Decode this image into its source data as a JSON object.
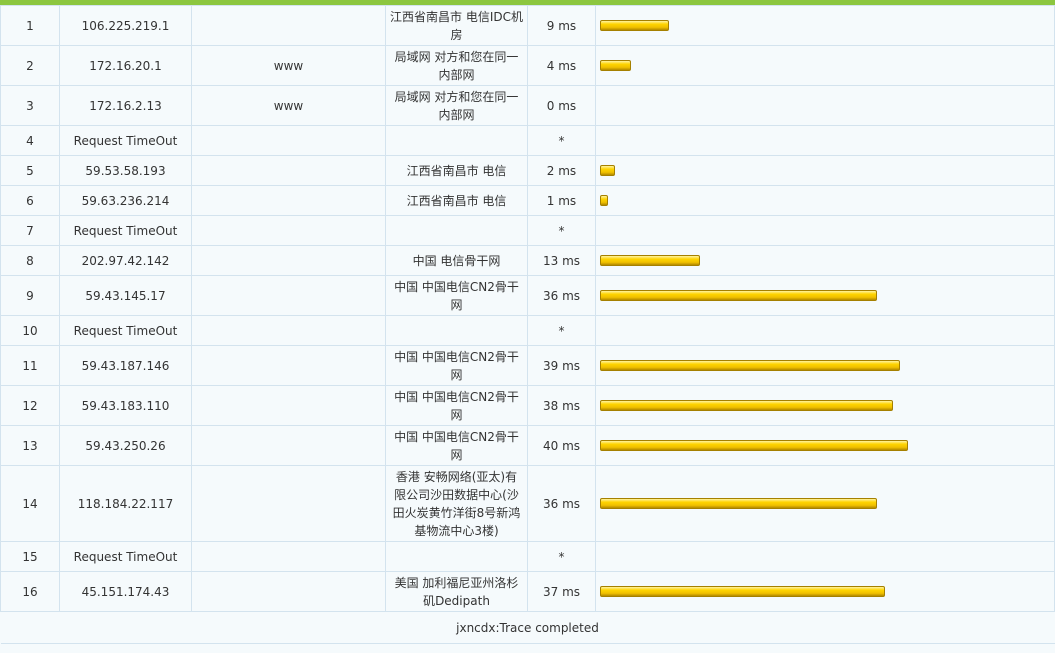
{
  "hops": [
    {
      "hop": "1",
      "ip": "106.225.219.1",
      "host": "",
      "location": "江西省南昌市 电信IDC机房",
      "rtt": "9 ms",
      "rtt_ms": 9
    },
    {
      "hop": "2",
      "ip": "172.16.20.1",
      "host": "www",
      "location": "局域网 对方和您在同一内部网",
      "rtt": "4 ms",
      "rtt_ms": 4
    },
    {
      "hop": "3",
      "ip": "172.16.2.13",
      "host": "www",
      "location": "局域网 对方和您在同一内部网",
      "rtt": "0 ms",
      "rtt_ms": 0
    },
    {
      "hop": "4",
      "ip": "Request TimeOut",
      "host": "",
      "location": "",
      "rtt": "*",
      "rtt_ms": null
    },
    {
      "hop": "5",
      "ip": "59.53.58.193",
      "host": "",
      "location": "江西省南昌市 电信",
      "rtt": "2 ms",
      "rtt_ms": 2
    },
    {
      "hop": "6",
      "ip": "59.63.236.214",
      "host": "",
      "location": "江西省南昌市 电信",
      "rtt": "1 ms",
      "rtt_ms": 1
    },
    {
      "hop": "7",
      "ip": "Request TimeOut",
      "host": "",
      "location": "",
      "rtt": "*",
      "rtt_ms": null
    },
    {
      "hop": "8",
      "ip": "202.97.42.142",
      "host": "",
      "location": "中国 电信骨干网",
      "rtt": "13 ms",
      "rtt_ms": 13
    },
    {
      "hop": "9",
      "ip": "59.43.145.17",
      "host": "",
      "location": "中国 中国电信CN2骨干网",
      "rtt": "36 ms",
      "rtt_ms": 36
    },
    {
      "hop": "10",
      "ip": "Request TimeOut",
      "host": "",
      "location": "",
      "rtt": "*",
      "rtt_ms": null
    },
    {
      "hop": "11",
      "ip": "59.43.187.146",
      "host": "",
      "location": "中国 中国电信CN2骨干网",
      "rtt": "39 ms",
      "rtt_ms": 39
    },
    {
      "hop": "12",
      "ip": "59.43.183.110",
      "host": "",
      "location": "中国 中国电信CN2骨干网",
      "rtt": "38 ms",
      "rtt_ms": 38
    },
    {
      "hop": "13",
      "ip": "59.43.250.26",
      "host": "",
      "location": "中国 中国电信CN2骨干网",
      "rtt": "40 ms",
      "rtt_ms": 40
    },
    {
      "hop": "14",
      "ip": "118.184.22.117",
      "host": "",
      "location": "香港 安畅网络(亚太)有限公司沙田数据中心(沙田火炭黄竹洋街8号新鸿基物流中心3楼)",
      "rtt": "36 ms",
      "rtt_ms": 36
    },
    {
      "hop": "15",
      "ip": "Request TimeOut",
      "host": "",
      "location": "",
      "rtt": "*",
      "rtt_ms": null
    },
    {
      "hop": "16",
      "ip": "45.151.174.43",
      "host": "",
      "location": "美国 加利福尼亚州洛杉矶Dedipath",
      "rtt": "37 ms",
      "rtt_ms": 37
    }
  ],
  "footer": {
    "status": "jxncdx:Trace completed"
  },
  "colors": {
    "accent_bar": "#8cc63f",
    "latency_bar": "#ffd400",
    "grid": "#d3e3ee",
    "background": "#f5fafc"
  }
}
